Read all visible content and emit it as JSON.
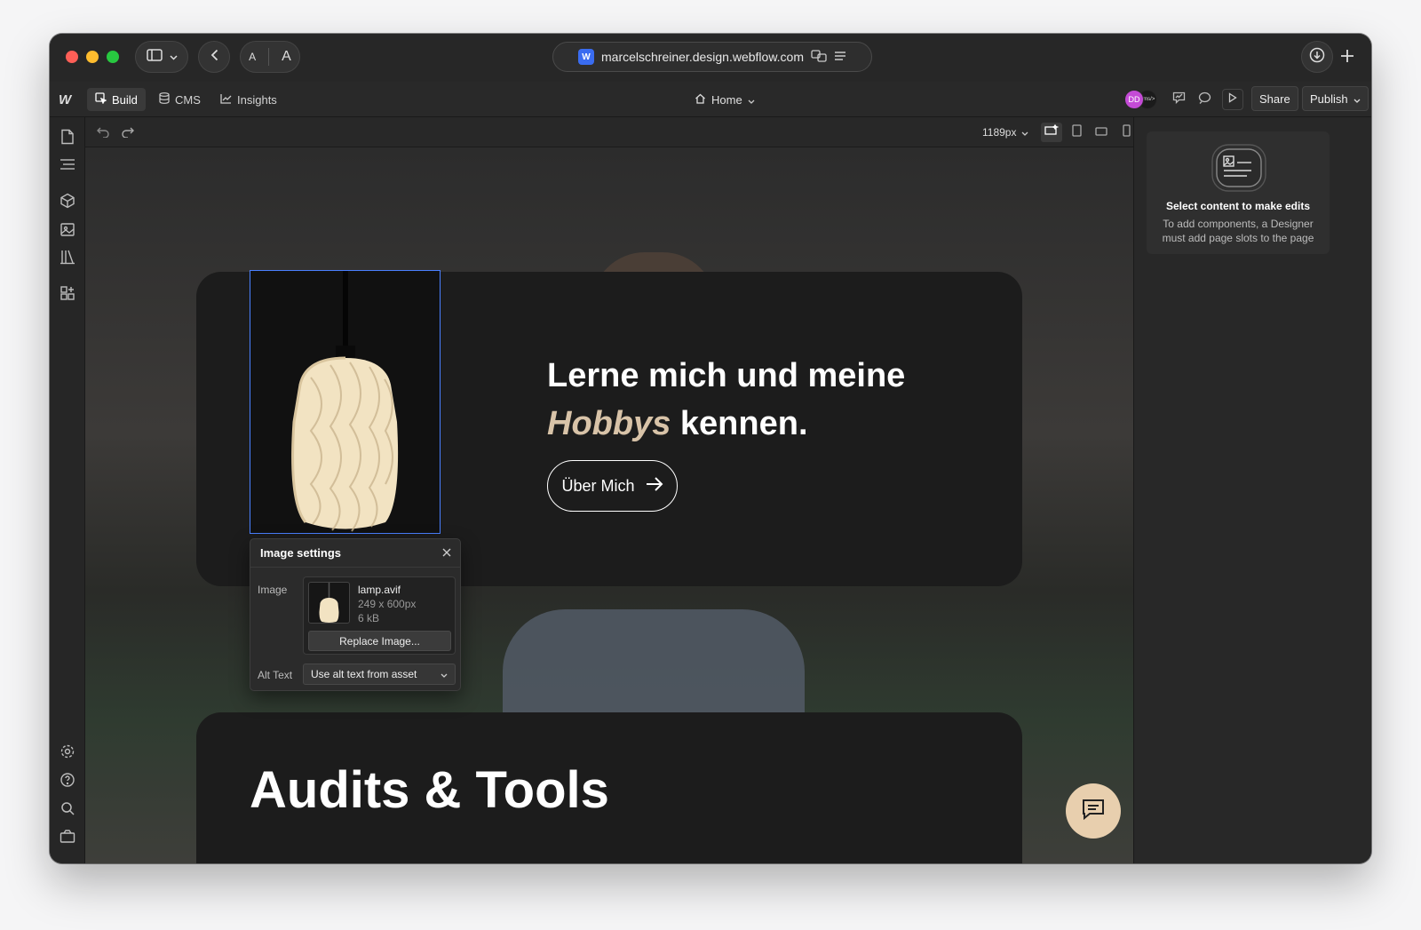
{
  "browser": {
    "url": "marcelschreiner.design.webflow.com",
    "text_small": "A",
    "text_large": "A"
  },
  "appbar": {
    "logo": "W",
    "tabs": [
      {
        "label": "Build",
        "icon": "cursor-icon"
      },
      {
        "label": "CMS",
        "icon": "database-icon"
      },
      {
        "label": "Insights",
        "icon": "chart-icon"
      }
    ],
    "page_selector": "Home",
    "avatar_initials": "DD",
    "avatar2_label": "<ms/>",
    "share_label": "Share",
    "publish_label": "Publish"
  },
  "canvas_bar": {
    "width_value": "1189px"
  },
  "site": {
    "headline_line1": "Lerne mich und meine",
    "headline_italic": "Hobbys",
    "headline_rest": " kennen.",
    "cta_label": "Über Mich",
    "section2_title": "Audits & Tools"
  },
  "image_settings": {
    "title": "Image settings",
    "image_label": "Image",
    "file_name": "lamp.avif",
    "dimensions": "249 x 600px",
    "file_size": "6 kB",
    "replace_label": "Replace Image...",
    "alt_label": "Alt Text",
    "alt_value": "Use alt text from asset"
  },
  "right_panel": {
    "title": "Select content to make edits",
    "description": "To add components, a Designer must add page slots to the page"
  },
  "colors": {
    "accent_blue": "#4a80ff",
    "hobbys_beige": "#d8c3a8",
    "chat_button": "#e8cfae",
    "avatar": "#c44bd6"
  }
}
